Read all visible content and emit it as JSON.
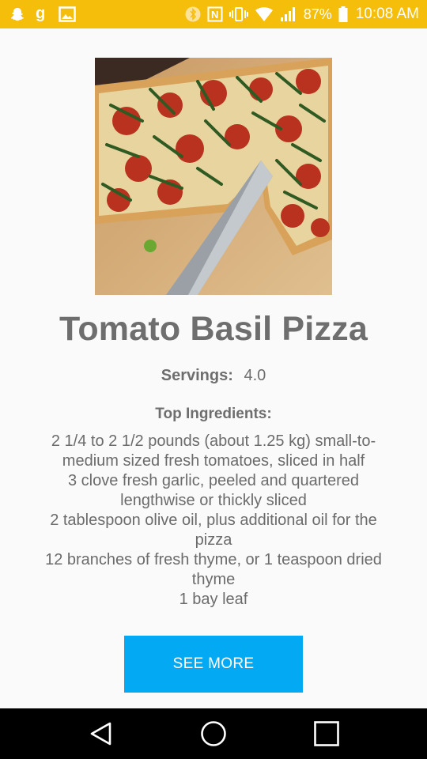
{
  "status_bar": {
    "battery_percent": "87%",
    "time": "10:08 AM",
    "background": "#f5be0a",
    "icons_left": [
      "snapchat-icon",
      "g-app-icon",
      "gallery-icon"
    ],
    "icons_right": [
      "bluetooth-icon",
      "nfc-icon",
      "vibrate-icon",
      "wifi-icon",
      "signal-icon",
      "battery-icon"
    ]
  },
  "recipe": {
    "image_icon": "pizza-photo",
    "title": "Tomato Basil Pizza",
    "servings_label": "Servings:",
    "servings_value": "4.0",
    "ingredients_label": "Top Ingredients:",
    "ingredients": [
      "2 1/4 to 2 1/2 pounds (about 1.25 kg) small-to-medium sized fresh tomatoes, sliced in half",
      "3 clove fresh garlic, peeled and quartered lengthwise or thickly sliced",
      "2 tablespoon olive oil, plus additional oil for the pizza",
      "12 branches of fresh thyme, or 1 teaspoon dried thyme",
      "1 bay leaf"
    ],
    "see_more_label": "SEE MORE",
    "accent_color": "#04a9f4"
  },
  "nav_bar": {
    "back_icon": "back-triangle-icon",
    "home_icon": "home-circle-icon",
    "recents_icon": "recents-square-icon"
  }
}
